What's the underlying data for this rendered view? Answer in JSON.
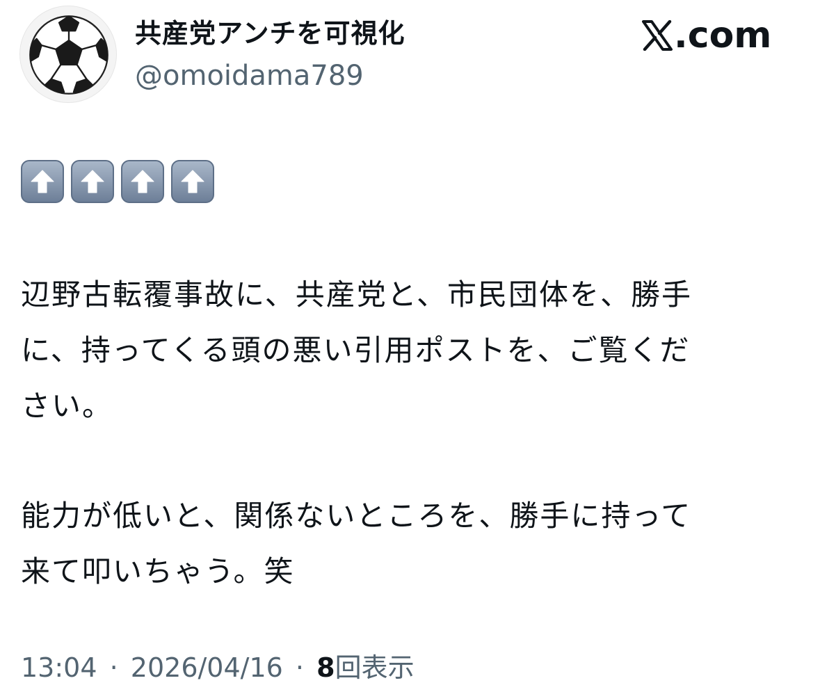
{
  "post": {
    "author": {
      "display_name": "共産党アンチを可視化",
      "handle": "@omoidama789",
      "avatar_icon": "soccer-ball-icon"
    },
    "site_logo": {
      "mark": "𝕏",
      "text": ".com"
    },
    "emoji_row": [
      "up-arrow-icon",
      "up-arrow-icon",
      "up-arrow-icon",
      "up-arrow-icon"
    ],
    "paragraph1": [
      "辺野古転覆事故に、共産党と、市民団体を、勝手",
      "に、持ってくる頭の悪い引用ポストを、ご覧くだ",
      "さい。"
    ],
    "paragraph2": [
      "能力が低いと、関係ないところを、勝手に持って",
      "来て叩いちゃう。笑"
    ],
    "meta": {
      "time": "13:04",
      "separator": "·",
      "date": "2026/04/16",
      "views_count": "8",
      "views_label": "回表示"
    }
  }
}
